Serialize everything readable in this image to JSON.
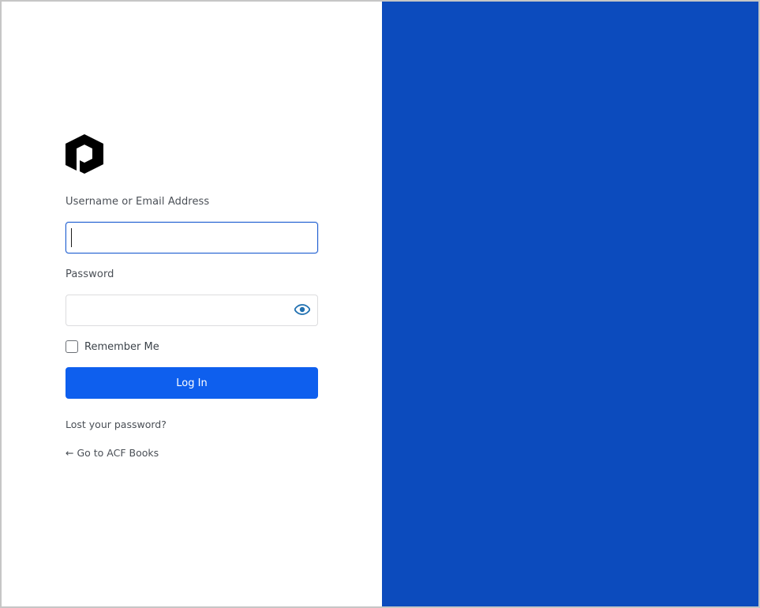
{
  "brand": {
    "logo_icon": "cube-logo-icon"
  },
  "form": {
    "username_label": "Username or Email Address",
    "username_value": "",
    "password_label": "Password",
    "password_value": "",
    "password_toggle_icon": "eye-icon",
    "remember_label": "Remember Me",
    "remember_checked": false,
    "submit_label": "Log In"
  },
  "links": {
    "lost_password": "Lost your password?",
    "back_to_site": "← Go to ACF Books"
  },
  "colors": {
    "accent_panel": "#0c4bbd",
    "button": "#0e5fee",
    "focus_border": "#1f5fd1"
  }
}
